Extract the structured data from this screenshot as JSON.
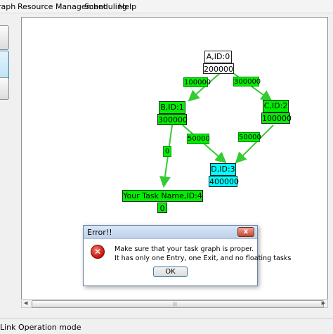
{
  "menu": {
    "items": [
      "raph",
      "Resource Management",
      "Scheduling",
      "Help"
    ]
  },
  "graph": {
    "nodes": {
      "a": {
        "name": "A,ID:0",
        "value": "200000"
      },
      "b": {
        "name": "B,ID:1",
        "value": "300000"
      },
      "c": {
        "name": "C,ID:2",
        "value": "100000"
      },
      "d": {
        "name": "D,ID:3",
        "value": "400000"
      },
      "e": {
        "name": "Your Task Name,ID:4",
        "value": "0"
      }
    },
    "edges": {
      "ab": "100000",
      "ac": "300000",
      "bd": "50000",
      "cd": "50000",
      "be": "0"
    },
    "colors": {
      "node_white": "#ffffff",
      "node_green": "#00ee00",
      "node_cyan": "#00ffff",
      "edge": "#33cc33"
    }
  },
  "dialog": {
    "title": "Error!!",
    "close_label": "x",
    "icon": "error-icon",
    "message_line1": "Make sure that your task graph is proper.",
    "message_line2": "It has only one Entry, one Exit, and no floating tasks",
    "ok_label": "OK"
  },
  "status": {
    "text": "Link Operation mode"
  }
}
